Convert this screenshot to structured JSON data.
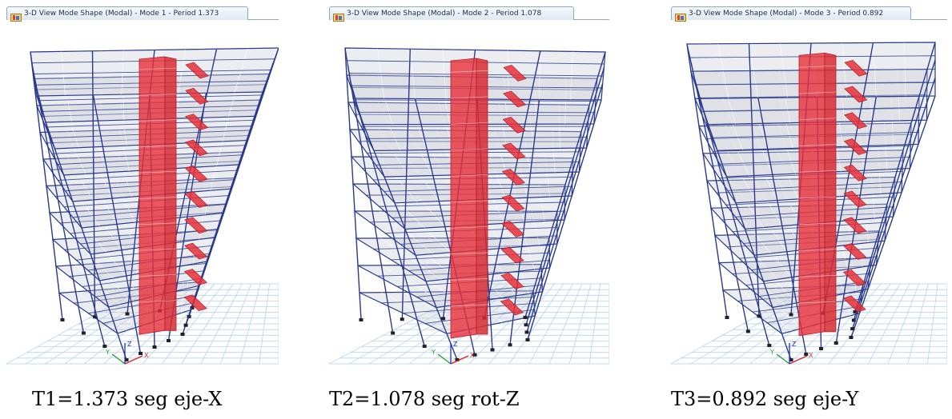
{
  "panels": [
    {
      "tab_title": "3-D View  Mode Shape (Modal) - Mode 1 - Period 1.373",
      "caption": "T1=1.373 seg eje-X",
      "mode": 1,
      "period": 1.373,
      "axis_labels": [
        "X",
        "Y",
        "Z"
      ]
    },
    {
      "tab_title": "3-D View  Mode Shape (Modal) - Mode 2 - Period 1.078",
      "caption": "T2=1.078 seg rot-Z",
      "mode": 2,
      "period": 1.078,
      "axis_labels": [
        "X",
        "Y",
        "Z"
      ]
    },
    {
      "tab_title": "3-D View  Mode Shape (Modal) - Mode 3 - Period 0.892",
      "caption": "T3=0.892 seg eje-Y",
      "mode": 3,
      "period": 0.892,
      "axis_labels": [
        "X",
        "Y",
        "Z"
      ]
    }
  ],
  "icons": {
    "tab": "etabs-view-icon"
  },
  "colors": {
    "frame": "#2a3a8c",
    "core": "#e8303a",
    "slab": "#c8ccd4",
    "grid": "#aecbec",
    "tab_border": "#8fa7c4"
  }
}
